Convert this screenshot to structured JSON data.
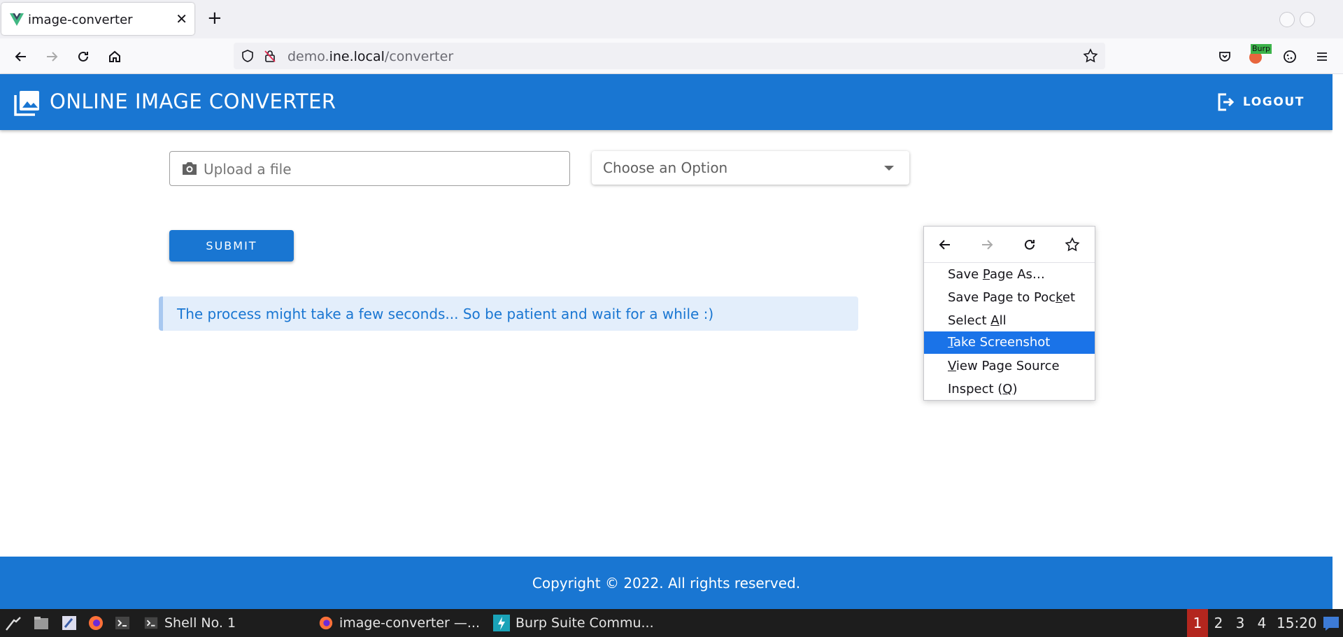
{
  "browser": {
    "tab_title": "image-converter",
    "url_scheme_host_prefix": "demo.",
    "url_host": "ine.local",
    "url_path": "/converter",
    "burp_badge": "Burp"
  },
  "app": {
    "title": "ONLINE IMAGE CONVERTER",
    "logout_label": "LOGOUT"
  },
  "form": {
    "upload_placeholder": "Upload a file",
    "select_placeholder": "Choose an Option",
    "submit_label": "SUBMIT"
  },
  "info_message": "The process might take a few seconds... So be patient and wait for a while :)",
  "footer_text": "Copyright © 2022. All rights reserved.",
  "context_menu": {
    "items": [
      {
        "pre": "Save ",
        "key": "P",
        "post": "age As…"
      },
      {
        "pre": "Save Page to Poc",
        "key": "k",
        "post": "et"
      },
      {
        "pre": "Select ",
        "key": "A",
        "post": "ll"
      },
      {
        "pre": "",
        "key": "T",
        "post": "ake Screenshot"
      },
      {
        "pre": "",
        "key": "V",
        "post": "iew Page Source"
      },
      {
        "pre": "Inspect (",
        "key": "Q",
        "post": ")"
      }
    ]
  },
  "taskbar": {
    "tasks": [
      "Shell No. 1",
      "image-converter —...",
      "Burp Suite Commu..."
    ],
    "workspaces": [
      "1",
      "2",
      "3",
      "4"
    ],
    "active_workspace": "1",
    "clock": "15:20"
  },
  "colors": {
    "primary": "#1976d2",
    "menu_highlight": "#1a73e8",
    "active_workspace": "#b3261e"
  }
}
